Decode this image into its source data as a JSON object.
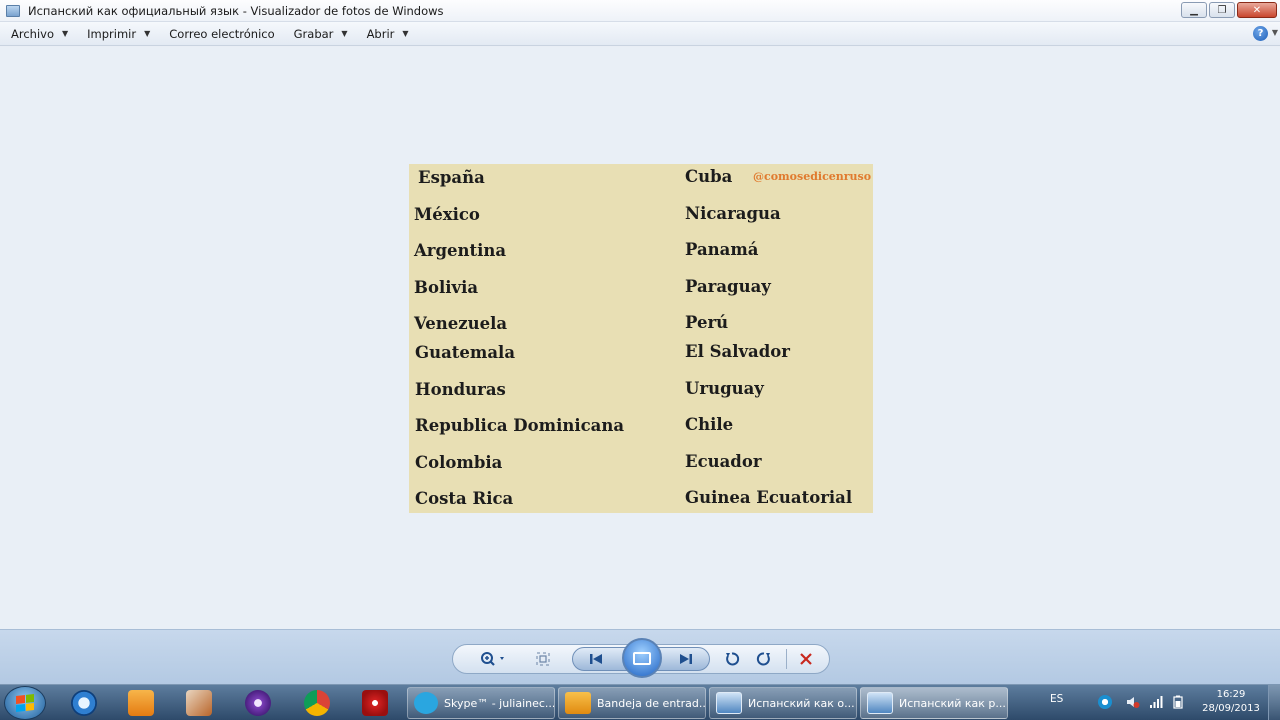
{
  "window": {
    "title": "Испанский как официальный язык - Visualizador de fotos de Windows",
    "buttons": {
      "minimize": "▁",
      "maximize": "❐",
      "close": "✕"
    }
  },
  "menu": {
    "items": [
      {
        "label": "Archivo",
        "has_arrow": true
      },
      {
        "label": "Imprimir",
        "has_arrow": true
      },
      {
        "label": "Correo electrónico",
        "has_arrow": false
      },
      {
        "label": "Grabar",
        "has_arrow": true
      },
      {
        "label": "Abrir",
        "has_arrow": true
      }
    ],
    "help_label": "?"
  },
  "photo": {
    "handle": "@comosedicenruso",
    "left_column": [
      "España",
      "México",
      "Argentina",
      "Bolivia",
      "Venezuela",
      "Guatemala",
      "Honduras",
      "Republica Dominicana",
      "Colombia",
      "Costa Rica"
    ],
    "right_column": [
      "Cuba",
      "Nicaragua",
      "Panamá",
      "Paraguay",
      "Perú",
      "El Salvador",
      "Uruguay",
      "Chile",
      "Ecuador",
      "Guinea Ecuatorial"
    ]
  },
  "controls": {
    "zoom_icon": "zoom-icon",
    "fit_icon": "fit-window-icon",
    "prev_icon": "previous-icon",
    "slideshow_icon": "slideshow-icon",
    "next_icon": "next-icon",
    "rotate_left_icon": "rotate-counterclockwise-icon",
    "rotate_right_icon": "rotate-clockwise-icon",
    "delete_icon": "delete-icon"
  },
  "taskbar": {
    "tasks": [
      {
        "label": "Skype™ - juliainec...",
        "color": "#2aa6e0"
      },
      {
        "label": "Bandeja de entrad...",
        "color": "#f0a21e"
      },
      {
        "label": "Испанский как о...",
        "color": "#5f8fbf"
      },
      {
        "label": "Испанский как р...",
        "color": "#5f8fbf"
      }
    ],
    "language": "ES",
    "time": "16:29",
    "date": "28/09/2013"
  },
  "colors": {
    "photo_bg": "#e8dfb4",
    "handle": "#e07a2e",
    "viewer_bg": "#e9eff6"
  }
}
